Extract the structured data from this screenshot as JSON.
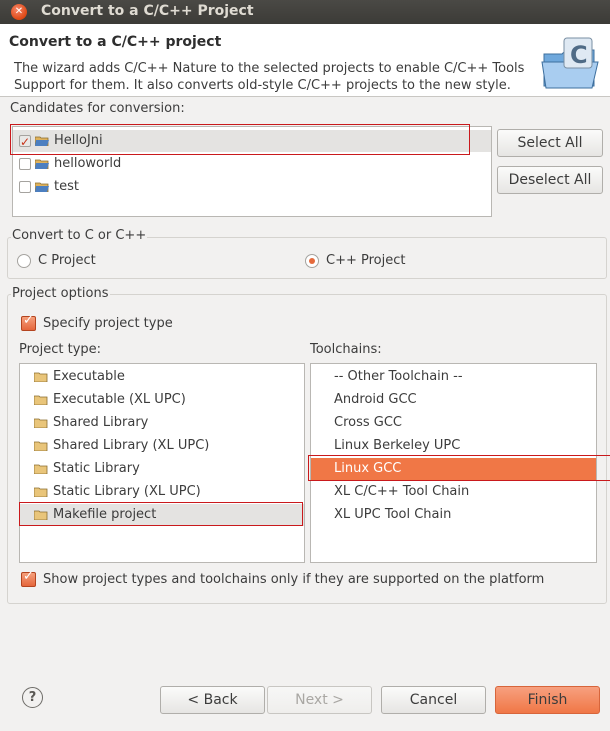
{
  "window": {
    "title": "Convert to a C/C++ Project"
  },
  "header": {
    "title": "Convert to a C/C++ project",
    "description": "The wizard adds C/C++ Nature to the selected projects to enable C/C++ Tools Support for them. It also converts old-style C/C++ projects to the new style."
  },
  "candidates": {
    "label": "Candidates for conversion:",
    "items": [
      {
        "name": "HelloJni",
        "checked": true
      },
      {
        "name": "helloworld",
        "checked": false
      },
      {
        "name": "test",
        "checked": false
      }
    ],
    "select_all": "Select All",
    "deselect_all": "Deselect All"
  },
  "convert": {
    "label": "Convert to C or C++",
    "c_project": "C Project",
    "cpp_project": "C++ Project",
    "selected": "cpp"
  },
  "options": {
    "label": "Project options",
    "specify_type": "Specify project type",
    "project_type_label": "Project type:",
    "toolchains_label": "Toolchains:",
    "project_types": [
      "Executable",
      "Executable (XL UPC)",
      "Shared Library",
      "Shared Library (XL UPC)",
      "Static Library",
      "Static Library (XL UPC)",
      "Makefile project"
    ],
    "selected_project_type": "Makefile project",
    "toolchains": [
      "-- Other Toolchain --",
      "Android GCC",
      "Cross GCC",
      "Linux Berkeley UPC",
      "Linux GCC",
      "XL C/C++ Tool Chain",
      "XL UPC Tool Chain"
    ],
    "selected_toolchain": "Linux GCC",
    "show_supported": "Show project types and toolchains only if they are supported on the platform"
  },
  "footer": {
    "help": "?",
    "back": "< Back",
    "next": "Next >",
    "cancel": "Cancel",
    "finish": "Finish"
  },
  "colors": {
    "accent": "#f07746",
    "highlight_box": "#c9191c",
    "titlebar": "#3c3b37"
  },
  "icons": {
    "close": "close-icon",
    "folder": "folder-icon",
    "wizard": "c-folder-wizard-icon",
    "help": "help-icon"
  }
}
